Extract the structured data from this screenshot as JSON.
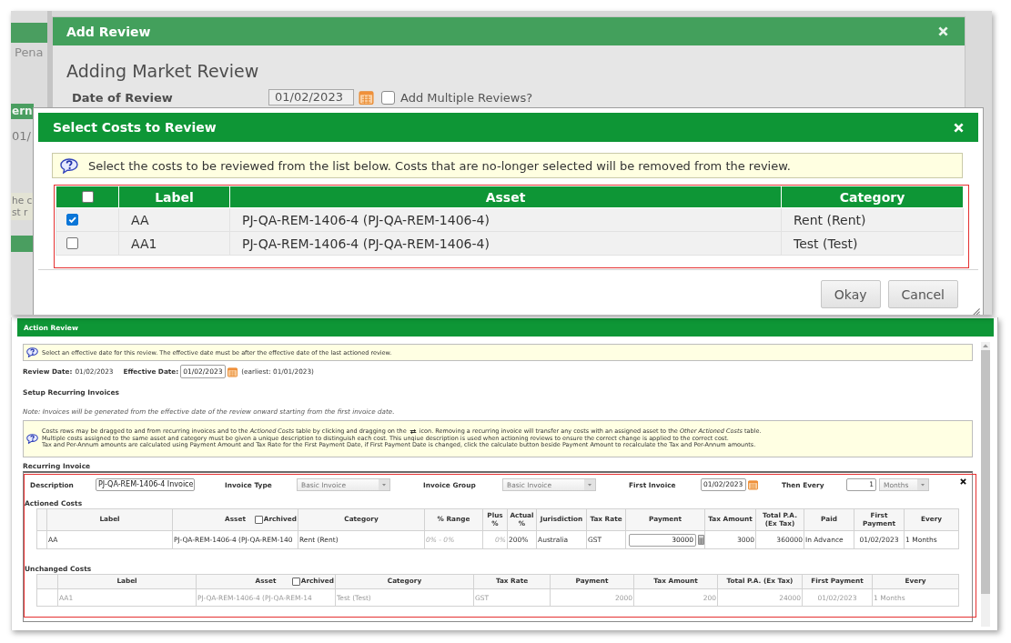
{
  "backdrop": {
    "menu_text": "Pena",
    "header_text": "ern",
    "date_text": "01/",
    "note_lines": [
      "he c",
      "st r"
    ]
  },
  "add_review": {
    "title": "Add Review",
    "heading": "Adding Market Review",
    "date_label": "Date of Review",
    "date_value": "01/02/2023",
    "multiple_label": "Add Multiple Reviews?",
    "multiple_checked": false
  },
  "select_costs": {
    "title": "Select Costs to Review",
    "info": "Select the costs to be reviewed from the list below. Costs that are no-longer selected will be removed from the review.",
    "select_all_checked": false,
    "columns": [
      "Label",
      "Asset",
      "Category"
    ],
    "rows": [
      {
        "checked": true,
        "cells": [
          "AA",
          "PJ-QA-REM-1406-4 (PJ-QA-REM-1406-4)",
          "Rent (Rent)"
        ]
      },
      {
        "checked": false,
        "cells": [
          "AA1",
          "PJ-QA-REM-1406-4 (PJ-QA-REM-1406-4)",
          "Test (Test)"
        ]
      }
    ],
    "buttons": [
      "Okay",
      "Cancel"
    ]
  },
  "action_review": {
    "title": "Action Review",
    "info": "Select an effective date for this review. The effective date must be after the effective date of the last actioned review.",
    "review_date": {
      "label": "Review Date:",
      "value": "01/02/2023"
    },
    "effective_date": {
      "label": "Effective Date:",
      "value": "01/02/2023",
      "earliest": "(earliest: 01/01/2023)"
    },
    "setup_heading": "Setup Recurring Invoices",
    "note": "Note: Invoices will be generated from the effective date of the review onward starting from the first invoice date.",
    "drag_info": {
      "first_line_before_icon": "Costs rows may be dragged to and from recurring invoices and to the *Actioned Costs* table by clicking and dragging on the",
      "first_line_after_icon": "icon. Removing a recurring invoice will transfer any costs with an assigned asset to the *Other Actioned Costs* table.",
      "other_lines": [
        "Multiple costs assigned to the same asset and category must be given a unique description to distinguish each cost. This unqiue description is used when actioning reviews to ensure the correct change is applied to the correct cost.",
        "Tax and Per-Annum amounts are calculated using Payment Amount and Tax Rate for the First Payment Date, if First Payment Date is changed, click the calculate button beside Payment Amount to recalculate the Tax and Per-Annum amounts."
      ]
    },
    "recurring_invoice": {
      "heading": "Recurring Invoice",
      "fields": [
        {
          "kind": "text",
          "label": "Description",
          "value": "PJ-QA-REM-1406-4 Invoice"
        },
        {
          "kind": "select",
          "label": "Invoice Type",
          "value": "Basic Invoice"
        },
        {
          "kind": "select",
          "label": "Invoice Group",
          "value": "Basic Invoice"
        },
        {
          "kind": "date",
          "label": "First Invoice",
          "value": "01/02/2023"
        },
        {
          "kind": "interval",
          "label": "Then Every",
          "value": "1",
          "unit": "Months"
        }
      ],
      "actioned_costs": {
        "heading": "Actioned Costs",
        "columns": [
          {
            "label": "Label",
            "kind": "text"
          },
          {
            "label": "Asset",
            "kind": "text",
            "toggle": {
              "label": "Archived",
              "checked": false
            }
          },
          {
            "label": "Category",
            "kind": "text"
          },
          {
            "label": "% Range",
            "kind": "hint"
          },
          {
            "label": "Plus %",
            "kind": "hint_number"
          },
          {
            "label": "Actual %",
            "kind": "text"
          },
          {
            "label": "Jurisdiction",
            "kind": "text"
          },
          {
            "label": "Tax Rate",
            "kind": "text"
          },
          {
            "label": "Payment",
            "kind": "input"
          },
          {
            "label": "Tax Amount",
            "kind": "number"
          },
          {
            "label": "Total P.A. (Ex Tax)",
            "kind": "number"
          },
          {
            "label": "Paid",
            "kind": "text"
          },
          {
            "label": "First Payment",
            "kind": "date"
          },
          {
            "label": "Every",
            "kind": "text"
          }
        ],
        "rows": [
          {
            "disabled": false,
            "cells": [
              "AA",
              "PJ-QA-REM-1406-4 (PJ-QA-REM-140",
              "Rent (Rent)",
              "0% - 0%",
              "0%",
              "200%",
              "Australia",
              "GST",
              "30000",
              "3000",
              "360000",
              "In Advance",
              "01/02/2023",
              "1 Months"
            ]
          }
        ]
      },
      "unchanged_costs": {
        "heading": "Unchanged Costs",
        "columns": [
          {
            "label": "Label",
            "kind": "text"
          },
          {
            "label": "Asset",
            "kind": "text",
            "toggle": {
              "label": "Archived",
              "checked": false
            }
          },
          {
            "label": "Category",
            "kind": "text"
          },
          {
            "label": "Tax Rate",
            "kind": "text"
          },
          {
            "label": "Payment",
            "kind": "number"
          },
          {
            "label": "Tax Amount",
            "kind": "number"
          },
          {
            "label": "Total P.A. (Ex Tax)",
            "kind": "number"
          },
          {
            "label": "First Payment",
            "kind": "date"
          },
          {
            "label": "Every",
            "kind": "text"
          }
        ],
        "rows": [
          {
            "disabled": true,
            "cells": [
              "AA1",
              "PJ-QA-REM-1406-4 (PJ-QA-REM-14",
              "Test (Test)",
              "GST",
              "2000",
              "200",
              "24000",
              "01/02/2023",
              "1 Months"
            ]
          }
        ]
      }
    }
  }
}
